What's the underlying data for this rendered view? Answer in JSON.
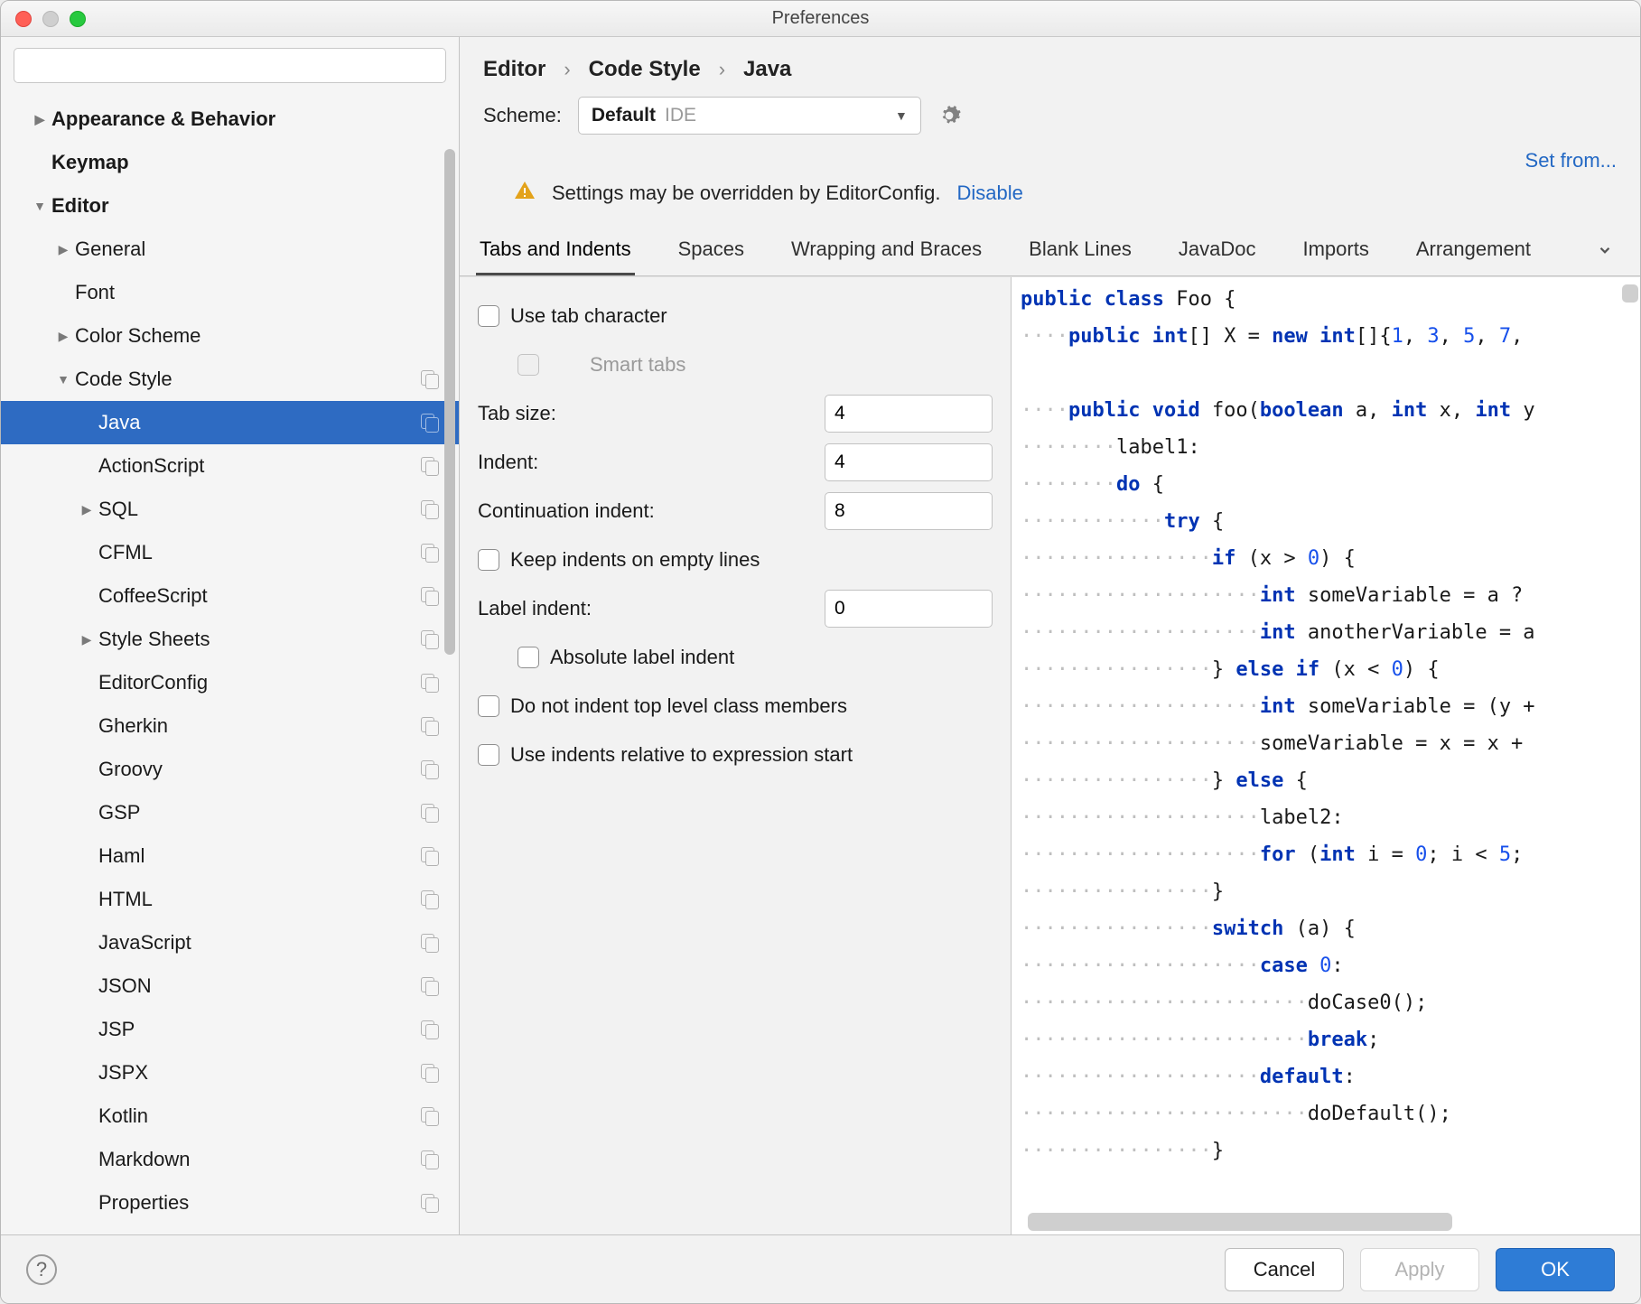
{
  "window": {
    "title": "Preferences"
  },
  "search": {
    "placeholder": ""
  },
  "sidebar": [
    {
      "label": "Appearance & Behavior",
      "indent": 1,
      "bold": true,
      "chev": "▶",
      "copy": false
    },
    {
      "label": "Keymap",
      "indent": 1,
      "bold": true,
      "chev": "",
      "copy": false
    },
    {
      "label": "Editor",
      "indent": 1,
      "bold": true,
      "chev": "▼",
      "copy": false
    },
    {
      "label": "General",
      "indent": 2,
      "chev": "▶",
      "copy": false
    },
    {
      "label": "Font",
      "indent": 2,
      "chev": "",
      "copy": false
    },
    {
      "label": "Color Scheme",
      "indent": 2,
      "chev": "▶",
      "copy": false
    },
    {
      "label": "Code Style",
      "indent": 2,
      "chev": "▼",
      "copy": true
    },
    {
      "label": "Java",
      "indent": 3,
      "chev": "",
      "copy": true,
      "selected": true
    },
    {
      "label": "ActionScript",
      "indent": 3,
      "chev": "",
      "copy": true
    },
    {
      "label": "SQL",
      "indent": 3,
      "chev": "▶",
      "copy": true
    },
    {
      "label": "CFML",
      "indent": 3,
      "chev": "",
      "copy": true
    },
    {
      "label": "CoffeeScript",
      "indent": 3,
      "chev": "",
      "copy": true
    },
    {
      "label": "Style Sheets",
      "indent": 3,
      "chev": "▶",
      "copy": true
    },
    {
      "label": "EditorConfig",
      "indent": 3,
      "chev": "",
      "copy": true
    },
    {
      "label": "Gherkin",
      "indent": 3,
      "chev": "",
      "copy": true
    },
    {
      "label": "Groovy",
      "indent": 3,
      "chev": "",
      "copy": true
    },
    {
      "label": "GSP",
      "indent": 3,
      "chev": "",
      "copy": true
    },
    {
      "label": "Haml",
      "indent": 3,
      "chev": "",
      "copy": true
    },
    {
      "label": "HTML",
      "indent": 3,
      "chev": "",
      "copy": true
    },
    {
      "label": "JavaScript",
      "indent": 3,
      "chev": "",
      "copy": true
    },
    {
      "label": "JSON",
      "indent": 3,
      "chev": "",
      "copy": true
    },
    {
      "label": "JSP",
      "indent": 3,
      "chev": "",
      "copy": true
    },
    {
      "label": "JSPX",
      "indent": 3,
      "chev": "",
      "copy": true
    },
    {
      "label": "Kotlin",
      "indent": 3,
      "chev": "",
      "copy": true
    },
    {
      "label": "Markdown",
      "indent": 3,
      "chev": "",
      "copy": true
    },
    {
      "label": "Properties",
      "indent": 3,
      "chev": "",
      "copy": true
    }
  ],
  "breadcrumb": [
    "Editor",
    "Code Style",
    "Java"
  ],
  "scheme": {
    "label": "Scheme:",
    "value": "Default",
    "scope": "IDE"
  },
  "set_from": "Set from...",
  "warning": {
    "text": "Settings may be overridden by EditorConfig.",
    "link": "Disable"
  },
  "subtabs": [
    "Tabs and Indents",
    "Spaces",
    "Wrapping and Braces",
    "Blank Lines",
    "JavaDoc",
    "Imports",
    "Arrangement"
  ],
  "active_tab": "Tabs and Indents",
  "form": {
    "use_tab_char": "Use tab character",
    "smart_tabs": "Smart tabs",
    "tab_size_label": "Tab size:",
    "tab_size": "4",
    "indent_label": "Indent:",
    "indent": "4",
    "cont_indent_label": "Continuation indent:",
    "cont_indent": "8",
    "keep_empty": "Keep indents on empty lines",
    "label_indent_label": "Label indent:",
    "label_indent": "0",
    "absolute_label": "Absolute label indent",
    "no_top_level": "Do not indent top level class members",
    "relative_expr": "Use indents relative to expression start"
  },
  "preview_lines": [
    [
      {
        "t": "public ",
        "c": "kw"
      },
      {
        "t": "class ",
        "c": "kw"
      },
      {
        "t": "Foo {"
      }
    ],
    [
      {
        "t": "····",
        "c": "dots"
      },
      {
        "t": "public ",
        "c": "kw"
      },
      {
        "t": "int",
        "c": "kw"
      },
      {
        "t": "[] X = "
      },
      {
        "t": "new ",
        "c": "kw"
      },
      {
        "t": "int",
        "c": "kw"
      },
      {
        "t": "[]{"
      },
      {
        "t": "1",
        "c": "n"
      },
      {
        "t": ", "
      },
      {
        "t": "3",
        "c": "n"
      },
      {
        "t": ", "
      },
      {
        "t": "5",
        "c": "n"
      },
      {
        "t": ", "
      },
      {
        "t": "7",
        "c": "n"
      },
      {
        "t": ","
      }
    ],
    [],
    [
      {
        "t": "····",
        "c": "dots"
      },
      {
        "t": "public ",
        "c": "kw"
      },
      {
        "t": "void ",
        "c": "kw"
      },
      {
        "t": "foo("
      },
      {
        "t": "boolean ",
        "c": "kw"
      },
      {
        "t": "a, "
      },
      {
        "t": "int ",
        "c": "kw"
      },
      {
        "t": "x, "
      },
      {
        "t": "int ",
        "c": "kw"
      },
      {
        "t": "y"
      }
    ],
    [
      {
        "t": "········",
        "c": "dots"
      },
      {
        "t": "label1:"
      }
    ],
    [
      {
        "t": "········",
        "c": "dots"
      },
      {
        "t": "do ",
        "c": "kw"
      },
      {
        "t": "{"
      }
    ],
    [
      {
        "t": "············",
        "c": "dots"
      },
      {
        "t": "try ",
        "c": "kw"
      },
      {
        "t": "{"
      }
    ],
    [
      {
        "t": "················",
        "c": "dots"
      },
      {
        "t": "if ",
        "c": "kw"
      },
      {
        "t": "(x > "
      },
      {
        "t": "0",
        "c": "n"
      },
      {
        "t": ") {"
      }
    ],
    [
      {
        "t": "····················",
        "c": "dots"
      },
      {
        "t": "int ",
        "c": "kw"
      },
      {
        "t": "someVariable = a ?"
      }
    ],
    [
      {
        "t": "····················",
        "c": "dots"
      },
      {
        "t": "int ",
        "c": "kw"
      },
      {
        "t": "anotherVariable = a"
      }
    ],
    [
      {
        "t": "················",
        "c": "dots"
      },
      {
        "t": "} "
      },
      {
        "t": "else ",
        "c": "kw"
      },
      {
        "t": "if ",
        "c": "kw"
      },
      {
        "t": "(x < "
      },
      {
        "t": "0",
        "c": "n"
      },
      {
        "t": ") {"
      }
    ],
    [
      {
        "t": "····················",
        "c": "dots"
      },
      {
        "t": "int ",
        "c": "kw"
      },
      {
        "t": "someVariable = (y +"
      }
    ],
    [
      {
        "t": "····················",
        "c": "dots"
      },
      {
        "t": "someVariable = x = x +"
      }
    ],
    [
      {
        "t": "················",
        "c": "dots"
      },
      {
        "t": "} "
      },
      {
        "t": "else ",
        "c": "kw"
      },
      {
        "t": "{"
      }
    ],
    [
      {
        "t": "····················",
        "c": "dots"
      },
      {
        "t": "label2:"
      }
    ],
    [
      {
        "t": "····················",
        "c": "dots"
      },
      {
        "t": "for ",
        "c": "kw"
      },
      {
        "t": "("
      },
      {
        "t": "int ",
        "c": "kw"
      },
      {
        "t": "i = "
      },
      {
        "t": "0",
        "c": "n"
      },
      {
        "t": "; i < "
      },
      {
        "t": "5",
        "c": "n"
      },
      {
        "t": ";"
      }
    ],
    [
      {
        "t": "················",
        "c": "dots"
      },
      {
        "t": "}"
      }
    ],
    [
      {
        "t": "················",
        "c": "dots"
      },
      {
        "t": "switch ",
        "c": "kw"
      },
      {
        "t": "(a) {"
      }
    ],
    [
      {
        "t": "····················",
        "c": "dots"
      },
      {
        "t": "case ",
        "c": "kw"
      },
      {
        "t": "0",
        "c": "n"
      },
      {
        "t": ":"
      }
    ],
    [
      {
        "t": "························",
        "c": "dots"
      },
      {
        "t": "doCase0();"
      }
    ],
    [
      {
        "t": "························",
        "c": "dots"
      },
      {
        "t": "break",
        "c": "kw"
      },
      {
        "t": ";"
      }
    ],
    [
      {
        "t": "····················",
        "c": "dots"
      },
      {
        "t": "default",
        "c": "kw"
      },
      {
        "t": ":"
      }
    ],
    [
      {
        "t": "························",
        "c": "dots"
      },
      {
        "t": "doDefault();"
      }
    ],
    [
      {
        "t": "················",
        "c": "dots"
      },
      {
        "t": "}"
      }
    ]
  ],
  "buttons": {
    "cancel": "Cancel",
    "apply": "Apply",
    "ok": "OK"
  }
}
